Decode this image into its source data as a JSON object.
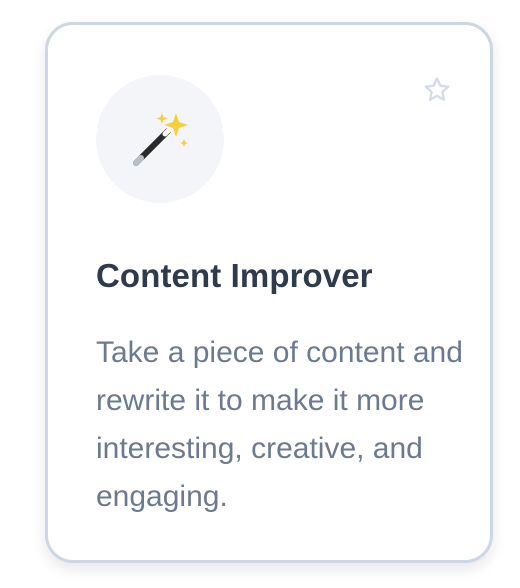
{
  "card": {
    "icon": "magic-wand-icon",
    "favorite_icon": "star-outline-icon",
    "title": "Content Improver",
    "description": "Take a piece of content and rewrite it to make it more interesting, creative, and engaging."
  },
  "colors": {
    "border": "#cdd6e3",
    "icon_background": "#f3f5f9",
    "title": "#2f3a4c",
    "description": "#6b7a90",
    "star": "#d3dbe6"
  }
}
